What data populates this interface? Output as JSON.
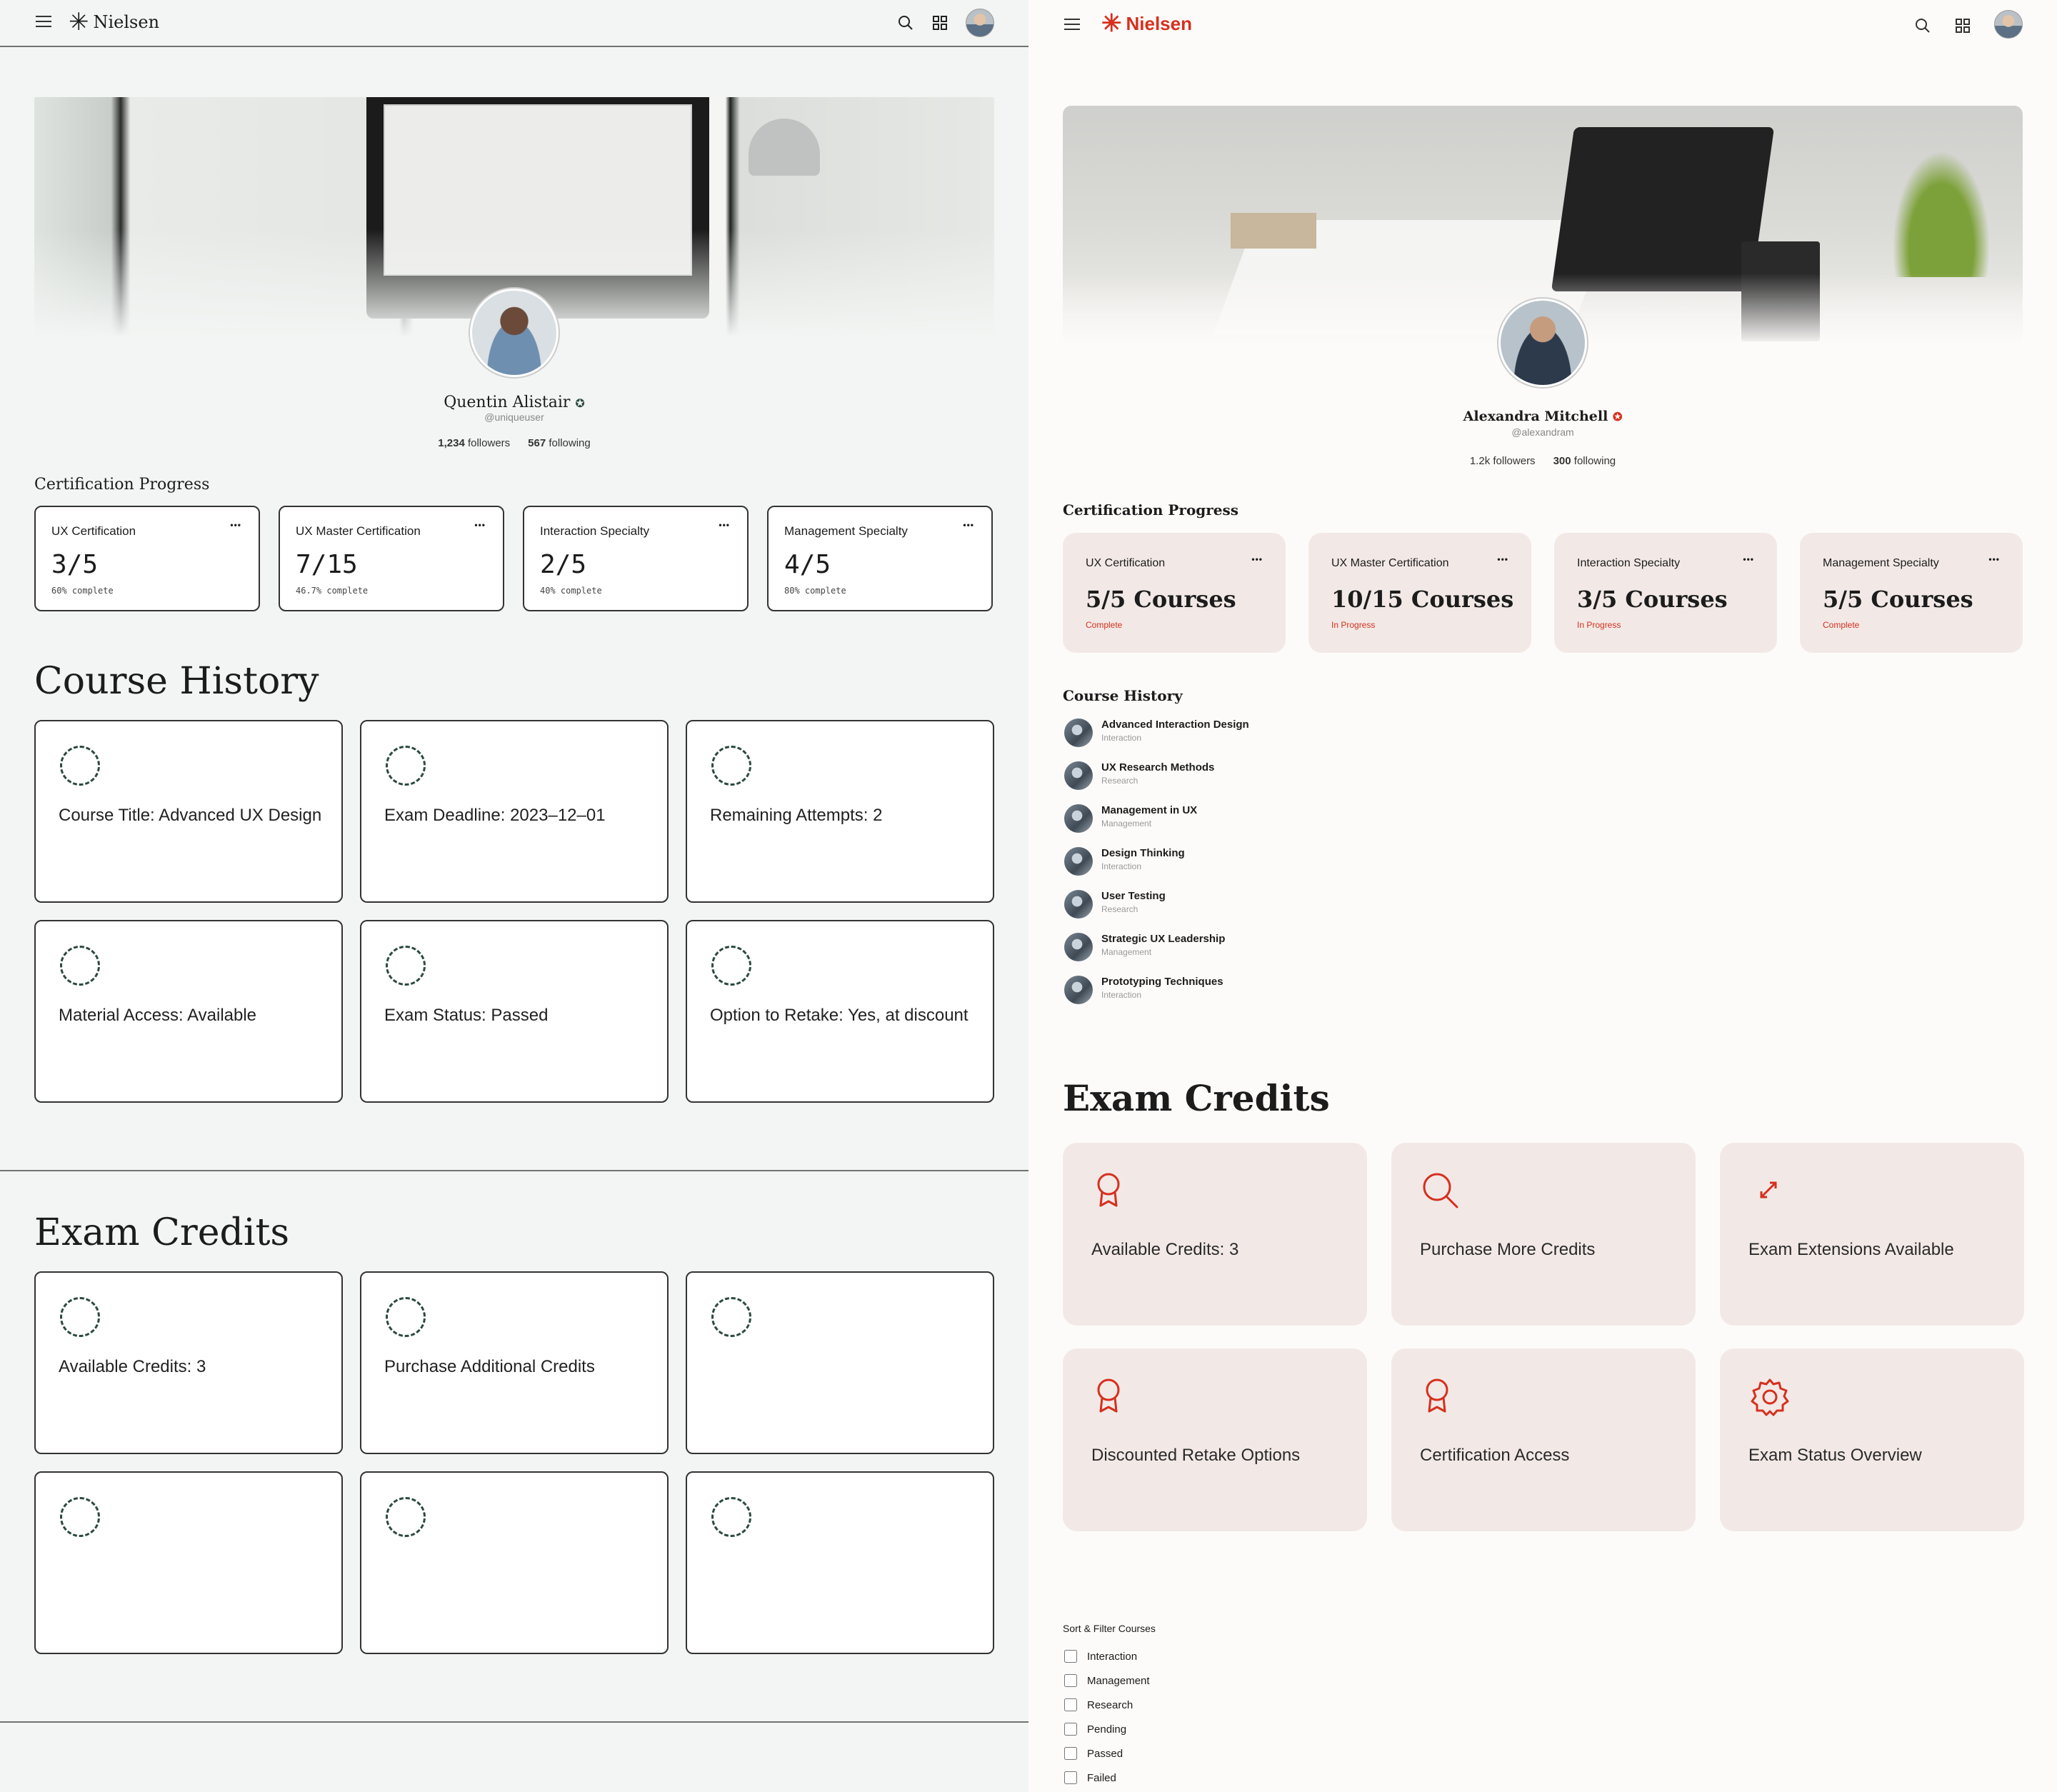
{
  "left": {
    "logo": "Nielsen",
    "profile": {
      "name": "Quentin Alistair",
      "handle": "@uniqueuser",
      "followers_count": "1,234",
      "followers_label": "followers",
      "following_count": "567",
      "following_label": "following"
    },
    "certification": {
      "title": "Certification Progress",
      "cards": [
        {
          "name": "UX Certification",
          "value": "3/5",
          "sub": "60% complete"
        },
        {
          "name": "UX Master Certification",
          "value": "7/15",
          "sub": "46.7% complete"
        },
        {
          "name": "Interaction Specialty",
          "value": "2/5",
          "sub": "40% complete"
        },
        {
          "name": "Management Specialty",
          "value": "4/5",
          "sub": "80% complete"
        }
      ]
    },
    "course_history": {
      "title": "Course History",
      "tiles": [
        "Course Title: Advanced UX Design",
        "Exam Deadline: 2023–12–01",
        "Remaining Attempts: 2",
        "Material Access: Available",
        "Exam Status: Passed",
        "Option to Retake: Yes, at discount"
      ]
    },
    "exam_credits": {
      "title": "Exam Credits",
      "tiles": [
        "Available Credits: 3",
        "Purchase Additional Credits",
        "",
        "",
        "",
        ""
      ]
    }
  },
  "right": {
    "logo": "Nielsen",
    "colors": {
      "accent": "#d6301e",
      "card_bg": "#f2e9e6",
      "page_bg": "#fdfbfa"
    },
    "profile": {
      "name": "Alexandra Mitchell",
      "handle": "@alexandram",
      "followers_count": "1.2k",
      "followers_label": "followers",
      "following_count": "300",
      "following_label": "following"
    },
    "certification": {
      "title": "Certification Progress",
      "cards": [
        {
          "name": "UX Certification",
          "value": "5/5 Courses",
          "sub": "Complete"
        },
        {
          "name": "UX Master Certification",
          "value": "10/15 Courses",
          "sub": "In Progress"
        },
        {
          "name": "Interaction Specialty",
          "value": "3/5 Courses",
          "sub": "In Progress"
        },
        {
          "name": "Management Specialty",
          "value": "5/5 Courses",
          "sub": "Complete"
        }
      ]
    },
    "course_history": {
      "title": "Course History",
      "items": [
        {
          "title": "Advanced Interaction Design",
          "category": "Interaction"
        },
        {
          "title": "UX Research Methods",
          "category": "Research"
        },
        {
          "title": "Management in UX",
          "category": "Management"
        },
        {
          "title": "Design Thinking",
          "category": "Interaction"
        },
        {
          "title": "User Testing",
          "category": "Research"
        },
        {
          "title": "Strategic UX Leadership",
          "category": "Management"
        },
        {
          "title": "Prototyping Techniques",
          "category": "Interaction"
        }
      ]
    },
    "exam_credits": {
      "title": "Exam Credits",
      "tiles": [
        {
          "label": "Available Credits: 3",
          "icon": "award-icon"
        },
        {
          "label": "Purchase More Credits",
          "icon": "search-icon"
        },
        {
          "label": "Exam Extensions Available",
          "icon": "expand-icon"
        },
        {
          "label": "Discounted Retake Options",
          "icon": "award-icon"
        },
        {
          "label": "Certification Access",
          "icon": "award-icon"
        },
        {
          "label": "Exam Status Overview",
          "icon": "gear-icon"
        }
      ]
    },
    "filters": {
      "title": "Sort & Filter Courses",
      "options": [
        "Interaction",
        "Management",
        "Research",
        "Pending",
        "Passed",
        "Failed"
      ]
    }
  }
}
